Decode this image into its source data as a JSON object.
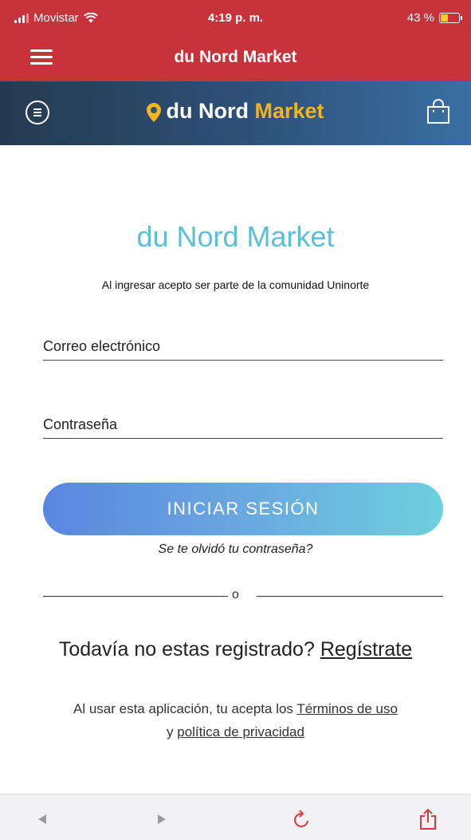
{
  "status_bar": {
    "carrier": "Movistar",
    "time": "4:19 p. m.",
    "battery_text": "43 %",
    "battery_level": 0.43
  },
  "app_bar": {
    "title": "du Nord Market",
    "menu_icon": "hamburger-icon"
  },
  "brand_header": {
    "logo_part1": "du Nord",
    "logo_part2": "Market",
    "menu_icon": "menu-circle-icon",
    "cart_icon": "shopping-bag-icon",
    "accent_color": "#f4b41a"
  },
  "login": {
    "title": "du Nord Market",
    "subtitle": "Al ingresar acepto ser parte de la comunidad Uninorte",
    "email_placeholder": "Correo electrónico",
    "password_placeholder": "Contraseña",
    "login_button": "INICIAR SESIÓN",
    "forgot_password": "Se te olvidó tu contraseña?",
    "or_separator": "o",
    "register_prompt": "Todavía no estas registrado?",
    "register_link": "Regístrate",
    "terms_prefix": "Al usar esta aplicación, tu acepta los",
    "terms_link": "Términos de uso",
    "terms_join": "y",
    "privacy_link": "política de privacidad"
  },
  "colors": {
    "app_bar": "#c8323b",
    "title_color": "#5bbfd8",
    "button_start": "#5a86e0",
    "button_end": "#6cd0de"
  },
  "browser_bar": {
    "icons": [
      "back-arrow-icon",
      "forward-arrow-icon",
      "reload-icon",
      "share-icon"
    ]
  }
}
